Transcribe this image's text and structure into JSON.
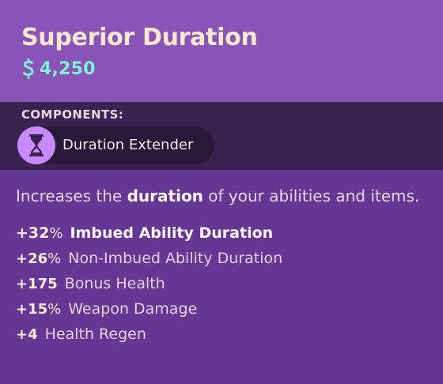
{
  "item": {
    "title": "Superior Duration",
    "price": "4,250",
    "price_icon": "souls-currency-icon"
  },
  "components": {
    "label": "COMPONENTS:",
    "items": [
      {
        "name": "Duration Extender",
        "icon": "hourglass-icon"
      }
    ]
  },
  "description": {
    "before": "Increases the ",
    "highlight": "duration",
    "after": " of your abilities and items."
  },
  "stats": [
    {
      "value": "+32",
      "suffix": "%",
      "label": "Imbued Ability Duration",
      "emphasis": true
    },
    {
      "value": "+26",
      "suffix": "%",
      "label": "Non-Imbued Ability Duration",
      "emphasis": false
    },
    {
      "value": "+175",
      "suffix": "",
      "label": "Bonus Health",
      "emphasis": false
    },
    {
      "value": "+15",
      "suffix": "%",
      "label": "Weapon Damage",
      "emphasis": false
    },
    {
      "value": "+4",
      "suffix": "",
      "label": "Health Regen",
      "emphasis": false
    }
  ],
  "colors": {
    "header_bg": "#8a54b6",
    "components_bg": "#3a2250",
    "body_bg": "#643792",
    "title": "#fbe7cf",
    "price": "#7ff0d8",
    "component_icon_bg": "#c88bff"
  }
}
